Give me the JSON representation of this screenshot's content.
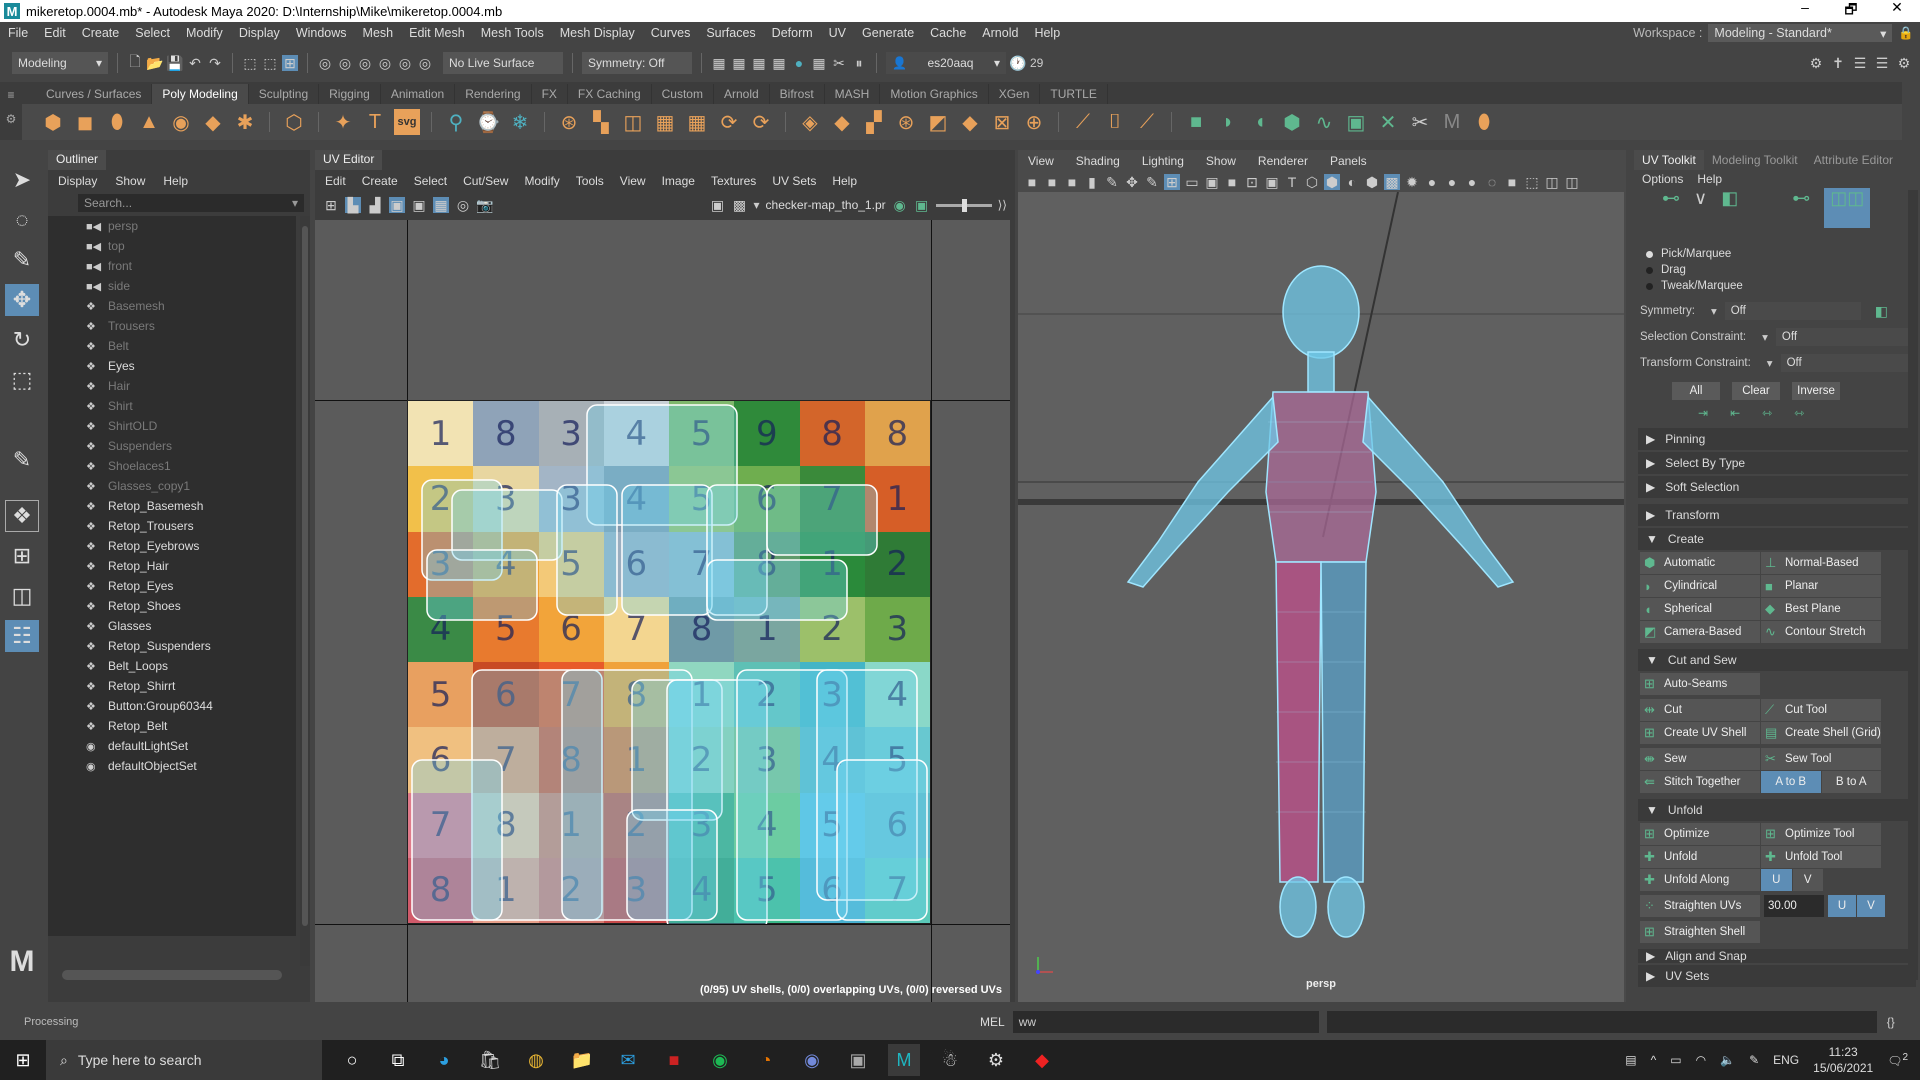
{
  "window": {
    "title": "mikeretop.0004.mb* - Autodesk Maya 2020: D:\\Internship\\Mike\\mikeretop.0004.mb",
    "minimize": "–",
    "maximize": "🗗",
    "close": "✕"
  },
  "menubar": {
    "items": [
      "File",
      "Edit",
      "Create",
      "Select",
      "Modify",
      "Display",
      "Windows",
      "Mesh",
      "Edit Mesh",
      "Mesh Tools",
      "Mesh Display",
      "Curves",
      "Surfaces",
      "Deform",
      "UV",
      "Generate",
      "Cache",
      "Arnold",
      "Help"
    ],
    "workspace_label": "Workspace :",
    "workspace_value": "Modeling - Standard*"
  },
  "statusline": {
    "mode": "Modeling",
    "live_surface": "No Live Surface",
    "symmetry": "Symmetry: Off",
    "user": "es20aaq",
    "credits": "29"
  },
  "shelf": {
    "tabs": [
      "Curves / Surfaces",
      "Poly Modeling",
      "Sculpting",
      "Rigging",
      "Animation",
      "Rendering",
      "FX",
      "FX Caching",
      "Custom",
      "Arnold",
      "Bifrost",
      "MASH",
      "Motion Graphics",
      "XGen",
      "TURTLE"
    ],
    "active_tab": "Poly Modeling"
  },
  "outliner": {
    "title": "Outliner",
    "menu": [
      "Display",
      "Show",
      "Help"
    ],
    "search_placeholder": "Search...",
    "items": [
      {
        "label": "persp",
        "type": "camera",
        "dim": true
      },
      {
        "label": "top",
        "type": "camera",
        "dim": true
      },
      {
        "label": "front",
        "type": "camera",
        "dim": true
      },
      {
        "label": "side",
        "type": "camera",
        "dim": true
      },
      {
        "label": "Basemesh",
        "type": "mesh",
        "dim": true
      },
      {
        "label": "Trousers",
        "type": "mesh",
        "dim": true
      },
      {
        "label": "Belt",
        "type": "mesh",
        "dim": true
      },
      {
        "label": "Eyes",
        "type": "mesh",
        "dim": false
      },
      {
        "label": "Hair",
        "type": "mesh",
        "dim": true
      },
      {
        "label": "Shirt",
        "type": "mesh",
        "dim": true
      },
      {
        "label": "ShirtOLD",
        "type": "mesh",
        "dim": true
      },
      {
        "label": "Suspenders",
        "type": "mesh",
        "dim": true
      },
      {
        "label": "Shoelaces1",
        "type": "mesh",
        "dim": true
      },
      {
        "label": "Glasses_copy1",
        "type": "mesh",
        "dim": true
      },
      {
        "label": "Retop_Basemesh",
        "type": "mesh",
        "dim": false
      },
      {
        "label": "Retop_Trousers",
        "type": "mesh",
        "dim": false
      },
      {
        "label": "Retop_Eyebrows",
        "type": "mesh",
        "dim": false
      },
      {
        "label": "Retop_Hair",
        "type": "mesh",
        "dim": false
      },
      {
        "label": "Retop_Eyes",
        "type": "mesh",
        "dim": false
      },
      {
        "label": "Retop_Shoes",
        "type": "mesh",
        "dim": false
      },
      {
        "label": "Glasses",
        "type": "mesh",
        "dim": false
      },
      {
        "label": "Retop_Suspenders",
        "type": "mesh",
        "dim": false
      },
      {
        "label": "Belt_Loops",
        "type": "mesh",
        "dim": false
      },
      {
        "label": "Retop_Shirrt",
        "type": "mesh",
        "dim": false
      },
      {
        "label": "Button:Group60344",
        "type": "mesh",
        "dim": false
      },
      {
        "label": "Retop_Belt",
        "type": "mesh",
        "dim": false
      },
      {
        "label": "defaultLightSet",
        "type": "set",
        "dim": false
      },
      {
        "label": "defaultObjectSet",
        "type": "set",
        "dim": false
      }
    ]
  },
  "uv_editor": {
    "title": "UV Editor",
    "menu": [
      "Edit",
      "Create",
      "Select",
      "Cut/Sew",
      "Modify",
      "Tools",
      "View",
      "Image",
      "Textures",
      "UV Sets",
      "Help"
    ],
    "texture_name": "checker-map_tho_1.pr",
    "checker_numbers": [
      [
        "1",
        "8",
        "3",
        "4",
        "5",
        "9",
        "8",
        "8"
      ],
      [
        "2",
        "3",
        "3",
        "4",
        "5",
        "6",
        "7",
        "1"
      ],
      [
        "3",
        "4",
        "5",
        "6",
        "7",
        "8",
        "1",
        "2"
      ],
      [
        "4",
        "5",
        "6",
        "7",
        "8",
        "1",
        "2",
        "3"
      ],
      [
        "5",
        "6",
        "7",
        "8",
        "1",
        "2",
        "3",
        "4"
      ],
      [
        "6",
        "7",
        "8",
        "1",
        "2",
        "3",
        "4",
        "5"
      ],
      [
        "7",
        "8",
        "1",
        "2",
        "3",
        "4",
        "5",
        "6"
      ],
      [
        "8",
        "1",
        "2",
        "3",
        "4",
        "5",
        "6",
        "7"
      ]
    ],
    "status": "(0/95) UV shells, (0/0) overlapping UVs, (0/0) reversed UVs"
  },
  "viewport": {
    "menu": [
      "View",
      "Shading",
      "Lighting",
      "Show",
      "Renderer",
      "Panels"
    ],
    "camera_label": "persp"
  },
  "uv_toolkit": {
    "tabs": [
      "UV Toolkit",
      "Modeling Toolkit",
      "Attribute Editor"
    ],
    "menu": [
      "Options",
      "Help"
    ],
    "selection_modes": [
      {
        "label": "Pick/Marquee",
        "selected": true
      },
      {
        "label": "Drag",
        "selected": false
      },
      {
        "label": "Tweak/Marquee",
        "selected": false
      }
    ],
    "symmetry_label": "Symmetry:",
    "symmetry_value": "Off",
    "selection_constraint_label": "Selection Constraint:",
    "selection_constraint_value": "Off",
    "transform_constraint_label": "Transform Constraint:",
    "transform_constraint_value": "Off",
    "buttons": [
      "All",
      "Clear",
      "Inverse"
    ],
    "collapsed_sections": [
      "Pinning",
      "Select By Type",
      "Soft Selection",
      "Transform"
    ],
    "create": {
      "title": "Create",
      "items": [
        "Automatic",
        "Normal-Based",
        "Cylindrical",
        "Planar",
        "Spherical",
        "Best Plane",
        "Camera-Based",
        "Contour Stretch"
      ]
    },
    "cut_sew": {
      "title": "Cut and Sew",
      "auto_seams": "Auto-Seams",
      "items": [
        "Cut",
        "Cut Tool",
        "Create UV Shell",
        "Create Shell (Grid)",
        "Sew",
        "Sew Tool"
      ],
      "stitch": "Stitch Together",
      "a_to_b": "A to B",
      "b_to_a": "B to A"
    },
    "unfold": {
      "title": "Unfold",
      "items": [
        "Optimize",
        "Optimize Tool",
        "Unfold",
        "Unfold Tool"
      ],
      "unfold_along": "Unfold Along",
      "u": "U",
      "v": "V",
      "straighten_uvs": "Straighten UVs",
      "straighten_value": "30.00",
      "straighten_shell": "Straighten Shell"
    },
    "align_snap": "Align and Snap",
    "uv_sets": "UV Sets"
  },
  "commandline": {
    "status": "Processing",
    "lang": "MEL",
    "input": "ww"
  },
  "taskbar": {
    "search_placeholder": "Type here to search",
    "language": "ENG",
    "time": "11:23",
    "date": "15/06/2021",
    "notifications": "2"
  }
}
